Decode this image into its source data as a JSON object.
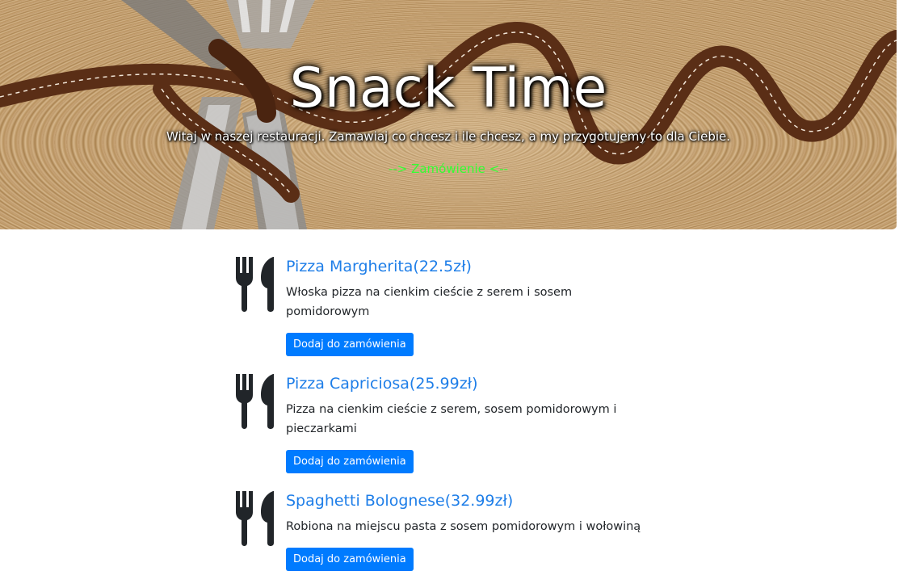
{
  "hero": {
    "title": "Snack Time",
    "subtitle": "Witaj w naszej restauracji. Zamawiaj co chcesz i ile chcesz, a my przygotujemy to dla Ciebie.",
    "order_link": "--> Zamówienie <--"
  },
  "menu": {
    "items": [
      {
        "name": "Pizza Margherita(22.5zł)",
        "description": "Włoska pizza na cienkim cieście z serem i sosem pomidorowym",
        "button": "Dodaj do zamówienia",
        "icon": "utensils-icon"
      },
      {
        "name": "Pizza Capriciosa(25.99zł)",
        "description": "Pizza na cienkim cieście z serem, sosem pomidorowym i pieczarkami",
        "button": "Dodaj do zamówienia",
        "icon": "utensils-icon"
      },
      {
        "name": "Spaghetti Bolognese(32.99zł)",
        "description": "Robiona na miejscu pasta z sosem pomidorowym i wołowiną",
        "button": "Dodaj do zamówienia",
        "icon": "utensils-icon"
      }
    ]
  },
  "colors": {
    "link_green": "#33ff33",
    "accent_blue": "#007bff",
    "title_blue": "#1e7ee8",
    "icon_dark": "#212529"
  }
}
